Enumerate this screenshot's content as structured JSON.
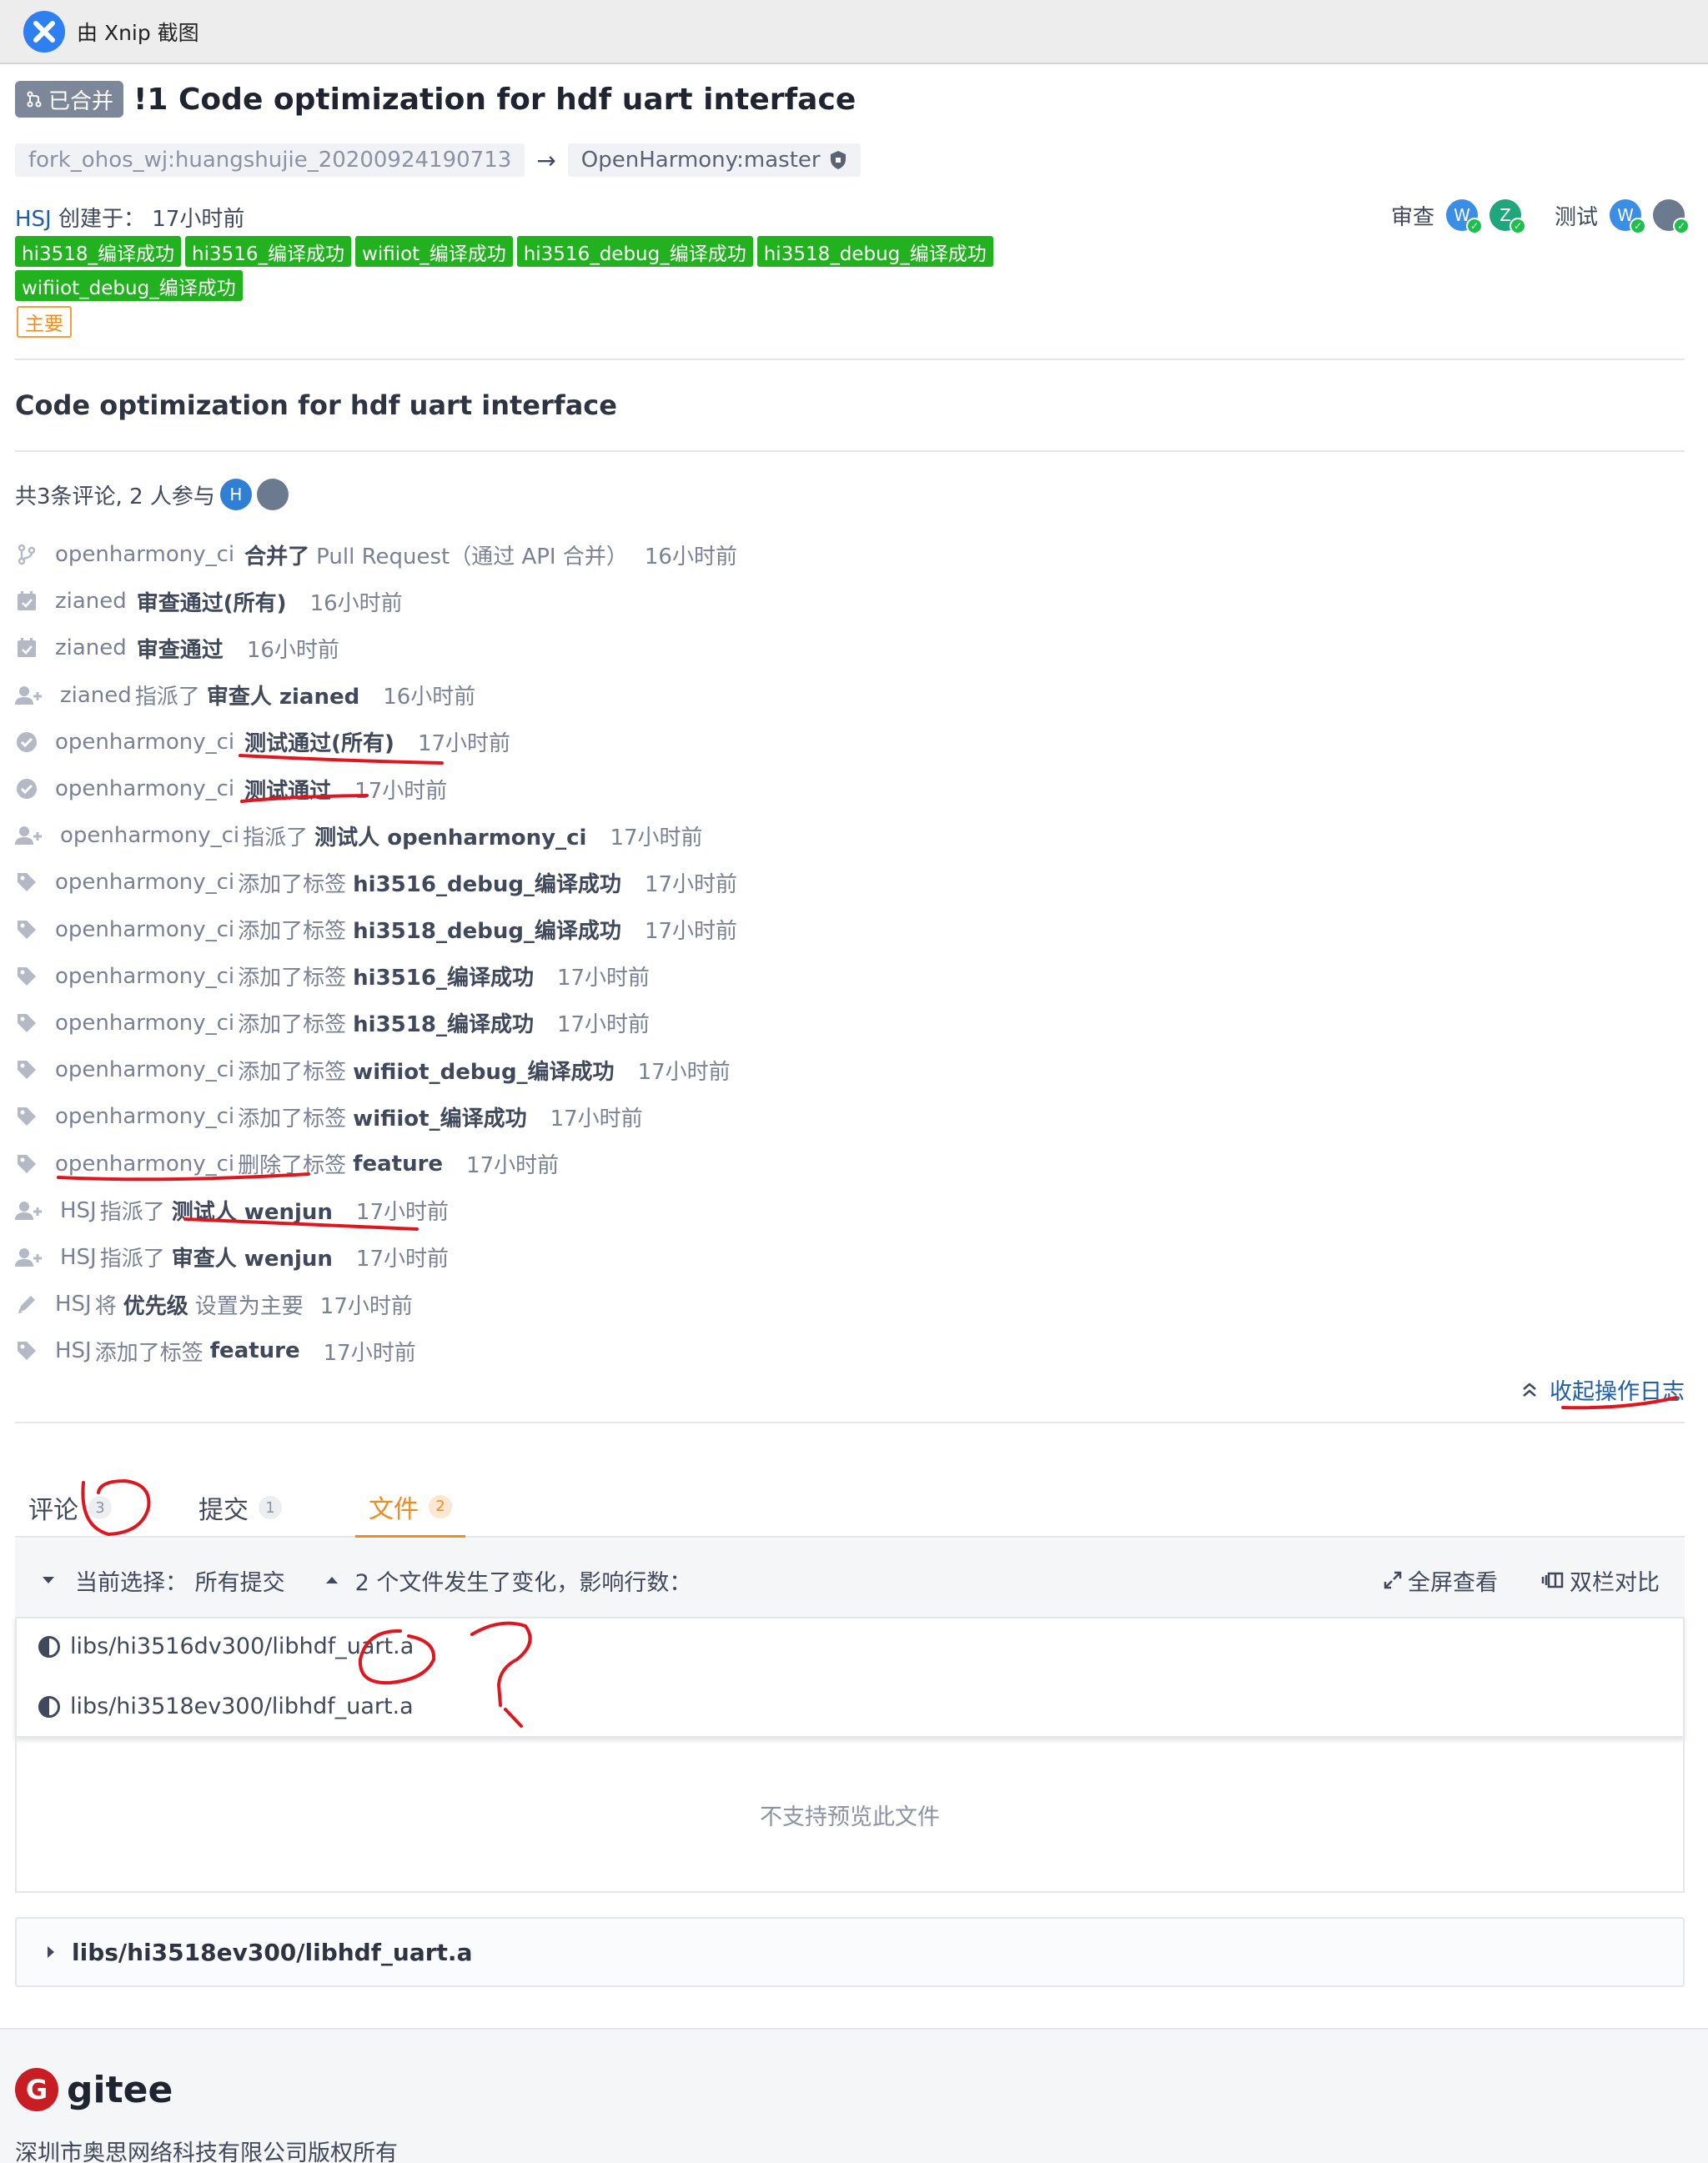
{
  "capture": {
    "text": "由 Xnip 截图"
  },
  "pr": {
    "status": "已合并",
    "title": "!1 Code optimization for hdf uart interface",
    "source_branch": "fork_ohos_wj:huangshujie_20200924190713",
    "target_branch": "OpenHarmony:master",
    "author": "HSJ",
    "created_label": "创建于：",
    "created_time": "17小时前",
    "labels": [
      "hi3518_编译成功",
      "hi3516_编译成功",
      "wifiiot_编译成功",
      "hi3516_debug_编译成功",
      "hi3518_debug_编译成功",
      "wifiiot_debug_编译成功"
    ],
    "priority": "主要",
    "reviewers_label": "审查",
    "testers_label": "测试",
    "reviewers": [
      {
        "initial": "W",
        "color": "#3a8ee6"
      },
      {
        "initial": "Z",
        "color": "#1fa67a"
      }
    ],
    "testers": [
      {
        "initial": "W",
        "color": "#3a8ee6"
      },
      {
        "initial": "",
        "color": "#6b7a8f"
      }
    ],
    "description": "Code optimization for hdf uart interface"
  },
  "summary": {
    "text": "共3条评论, 2 人参与",
    "participants": [
      "H",
      ""
    ]
  },
  "log": [
    {
      "icon": "merge-icon",
      "actor": "openharmony_ci",
      "pre": "",
      "strong": "合并了",
      "post": "Pull Request（通过 API 合并）",
      "time": "16小时前"
    },
    {
      "icon": "calendar-check-icon",
      "actor": "zianed",
      "pre": "",
      "strong": "审查通过(所有)",
      "post": "",
      "time": "16小时前"
    },
    {
      "icon": "calendar-check-icon",
      "actor": "zianed",
      "pre": "",
      "strong": "审查通过",
      "post": "",
      "time": "16小时前"
    },
    {
      "icon": "user-add-icon",
      "actor": "zianed",
      "pre": "指派了",
      "strong": "审查人 zianed",
      "post": "",
      "time": "16小时前"
    },
    {
      "icon": "check-circle-icon",
      "actor": "openharmony_ci",
      "pre": "",
      "strong": "测试通过(所有)",
      "post": "",
      "time": "17小时前"
    },
    {
      "icon": "check-circle-icon",
      "actor": "openharmony_ci",
      "pre": "",
      "strong": "测试通过",
      "post": "",
      "time": "17小时前"
    },
    {
      "icon": "user-add-icon",
      "actor": "openharmony_ci",
      "pre": "指派了",
      "strong": "测试人 openharmony_ci",
      "post": "",
      "time": "17小时前"
    },
    {
      "icon": "tag-icon",
      "actor": "openharmony_ci",
      "pre": "添加了标签",
      "strong": "hi3516_debug_编译成功",
      "post": "",
      "time": "17小时前"
    },
    {
      "icon": "tag-icon",
      "actor": "openharmony_ci",
      "pre": "添加了标签",
      "strong": "hi3518_debug_编译成功",
      "post": "",
      "time": "17小时前"
    },
    {
      "icon": "tag-icon",
      "actor": "openharmony_ci",
      "pre": "添加了标签",
      "strong": "hi3516_编译成功",
      "post": "",
      "time": "17小时前"
    },
    {
      "icon": "tag-icon",
      "actor": "openharmony_ci",
      "pre": "添加了标签",
      "strong": "hi3518_编译成功",
      "post": "",
      "time": "17小时前"
    },
    {
      "icon": "tag-icon",
      "actor": "openharmony_ci",
      "pre": "添加了标签",
      "strong": "wifiiot_debug_编译成功",
      "post": "",
      "time": "17小时前"
    },
    {
      "icon": "tag-icon",
      "actor": "openharmony_ci",
      "pre": "添加了标签",
      "strong": "wifiiot_编译成功",
      "post": "",
      "time": "17小时前"
    },
    {
      "icon": "tag-icon",
      "actor": "openharmony_ci",
      "pre": "删除了标签",
      "strong": "feature",
      "post": "",
      "time": "17小时前"
    },
    {
      "icon": "user-add-icon",
      "actor": "HSJ",
      "pre": "指派了",
      "strong": "测试人 wenjun",
      "post": "",
      "time": "17小时前"
    },
    {
      "icon": "user-add-icon",
      "actor": "HSJ",
      "pre": "指派了",
      "strong": "审查人 wenjun",
      "post": "",
      "time": "17小时前"
    },
    {
      "icon": "pencil-icon",
      "actor": "HSJ",
      "pre": "将",
      "strong": "优先级",
      "post": "设置为主要",
      "time": "17小时前"
    },
    {
      "icon": "tag-icon",
      "actor": "HSJ",
      "pre": "添加了标签",
      "strong": "feature",
      "post": "",
      "time": "17小时前"
    }
  ],
  "collapse_log": "收起操作日志",
  "tabs": [
    {
      "label": "评论",
      "count": "3"
    },
    {
      "label": "提交",
      "count": "1"
    },
    {
      "label": "文件",
      "count": "2"
    }
  ],
  "files_bar": {
    "selection": "当前选择：  所有提交",
    "changes": "2 个文件发生了变化，影响行数：",
    "fullscreen": "全屏查看",
    "split": "双栏对比"
  },
  "files": [
    "libs/hi3516dv300/libhdf_uart.a",
    "libs/hi3518ev300/libhdf_uart.a"
  ],
  "no_preview": "不支持预览此文件",
  "file_panel": "libs/hi3518ev300/libhdf_uart.a",
  "footer": {
    "brand": "gitee",
    "copyright": "深圳市奥思网络科技有限公司版权所有"
  }
}
